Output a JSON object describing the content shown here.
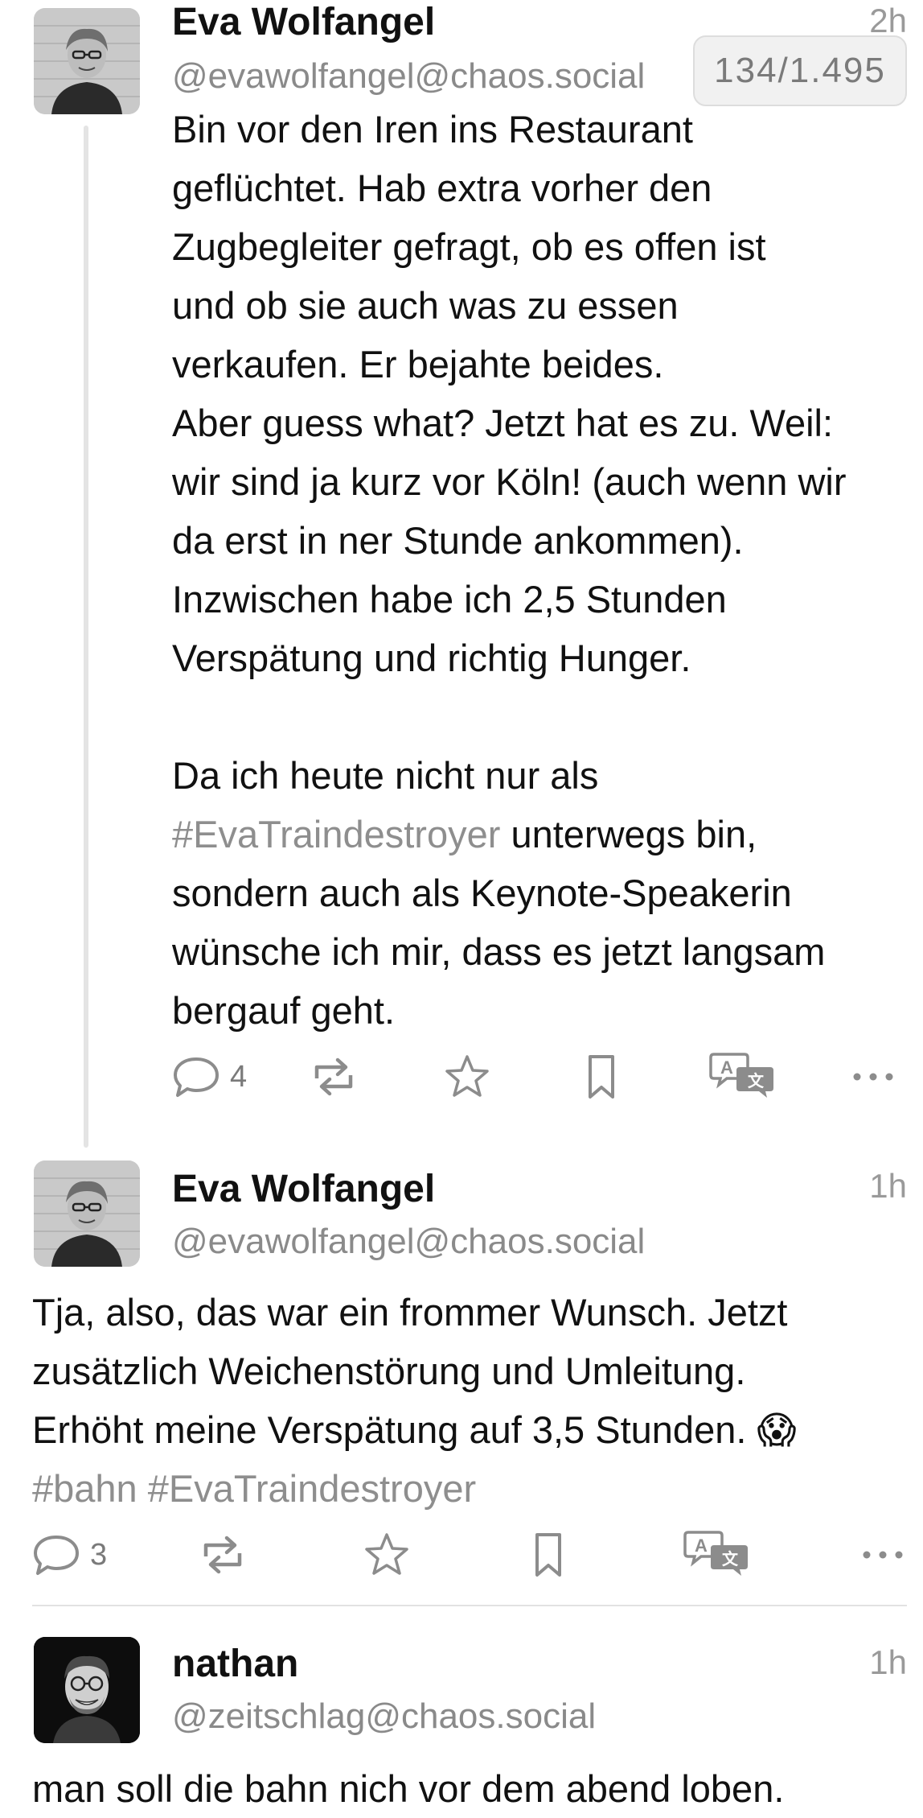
{
  "scroll_counter": "134/1.495",
  "posts": [
    {
      "author": "Eva Wolfangel",
      "handle": "@evawolfangel@chaos.social",
      "time": "2h",
      "lines": [
        "Bin vor den Iren ins Restaurant",
        "geflüchtet. Hab extra vorher den",
        "Zugbegleiter gefragt, ob es offen ist",
        "und ob sie auch was zu essen",
        "verkaufen. Er bejahte beides.",
        "Aber guess what? Jetzt hat es zu. Weil:",
        "wir sind ja kurz vor Köln! (auch wenn wir",
        "da erst in ner Stunde ankommen).",
        "Inzwischen habe ich 2,5 Stunden",
        "Verspätung und richtig Hunger.",
        "Da ich heute nicht nur als",
        "unterwegs bin,",
        "sondern auch als Keynote-Speakerin",
        "wünsche ich mir, dass es jetzt langsam",
        "bergauf geht."
      ],
      "hashtag_inline": "#EvaTraindestroyer",
      "reply_count": "4",
      "icons": [
        "reply-icon",
        "boost-icon",
        "favorite-icon",
        "bookmark-icon",
        "translate-icon",
        "more-icon"
      ]
    },
    {
      "author": "Eva Wolfangel",
      "handle": "@evawolfangel@chaos.social",
      "time": "1h",
      "lines": [
        "Tja, also, das war ein frommer Wunsch. Jetzt",
        "zusätzlich Weichenstörung und Umleitung.",
        "Erhöht meine Verspätung auf 3,5 Stunden."
      ],
      "emoji": "😱",
      "hashtags": "#bahn #EvaTraindestroyer",
      "reply_count": "3",
      "icons": [
        "reply-icon",
        "boost-icon",
        "favorite-icon",
        "bookmark-icon",
        "translate-icon",
        "more-icon"
      ]
    },
    {
      "author": "nathan",
      "handle": "@zeitschlag@chaos.social",
      "time": "1h",
      "lines": [
        "man soll die bahn nich vor dem abend loben."
      ]
    }
  ],
  "colors": {
    "text": "#111111",
    "secondary": "#8a8a8a",
    "hashtag": "#8e8e8e",
    "icon": "#8c8c8c"
  }
}
